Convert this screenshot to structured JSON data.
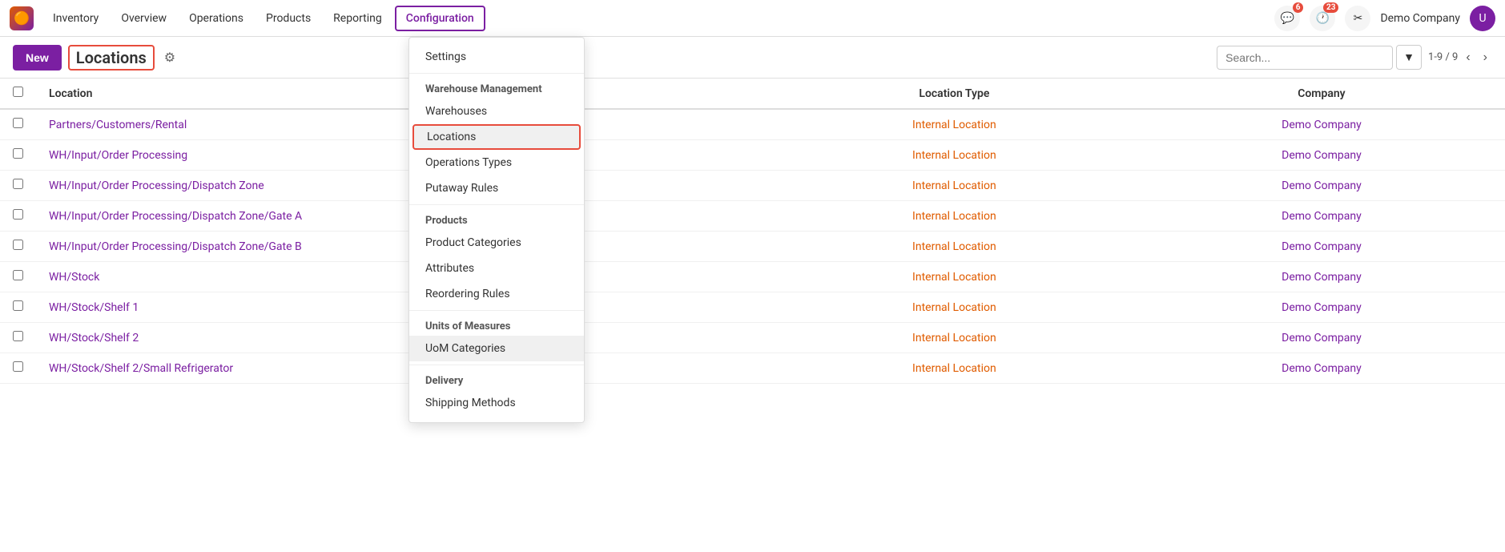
{
  "app": {
    "logo": "🟠",
    "title": "Inventory"
  },
  "topnav": {
    "items": [
      {
        "label": "Inventory",
        "active": false
      },
      {
        "label": "Overview",
        "active": false
      },
      {
        "label": "Operations",
        "active": false
      },
      {
        "label": "Products",
        "active": false
      },
      {
        "label": "Reporting",
        "active": false
      },
      {
        "label": "Configuration",
        "active": true
      }
    ],
    "notifications_count": "6",
    "clock_count": "23",
    "company": "Demo Company"
  },
  "toolbar": {
    "new_label": "New",
    "page_title": "Locations",
    "search_placeholder": "Search...",
    "pagination": "1-9 / 9"
  },
  "table": {
    "headers": [
      "Location",
      "Location Type",
      "Company"
    ],
    "rows": [
      {
        "location": "Partners/Customers/Rental",
        "type": "Internal Location",
        "company": "Demo Company"
      },
      {
        "location": "WH/Input/Order Processing",
        "type": "Internal Location",
        "company": "Demo Company"
      },
      {
        "location": "WH/Input/Order Processing/Dispatch Zone",
        "type": "Internal Location",
        "company": "Demo Company"
      },
      {
        "location": "WH/Input/Order Processing/Dispatch Zone/Gate A",
        "type": "Internal Location",
        "company": "Demo Company"
      },
      {
        "location": "WH/Input/Order Processing/Dispatch Zone/Gate B",
        "type": "Internal Location",
        "company": "Demo Company"
      },
      {
        "location": "WH/Stock",
        "type": "Internal Location",
        "company": "Demo Company"
      },
      {
        "location": "WH/Stock/Shelf 1",
        "type": "Internal Location",
        "company": "Demo Company"
      },
      {
        "location": "WH/Stock/Shelf 2",
        "type": "Internal Location",
        "company": "Demo Company"
      },
      {
        "location": "WH/Stock/Shelf 2/Small Refrigerator",
        "type": "Internal Location",
        "company": "Demo Company"
      }
    ]
  },
  "dropdown": {
    "settings_label": "Settings",
    "warehouse_mgmt_label": "Warehouse Management",
    "warehouses_label": "Warehouses",
    "locations_label": "Locations",
    "operations_types_label": "Operations Types",
    "putaway_rules_label": "Putaway Rules",
    "products_label": "Products",
    "product_categories_label": "Product Categories",
    "attributes_label": "Attributes",
    "reordering_rules_label": "Reordering Rules",
    "uom_label": "Units of Measures",
    "uom_categories_label": "UoM Categories",
    "delivery_label": "Delivery",
    "shipping_methods_label": "Shipping Methods"
  }
}
